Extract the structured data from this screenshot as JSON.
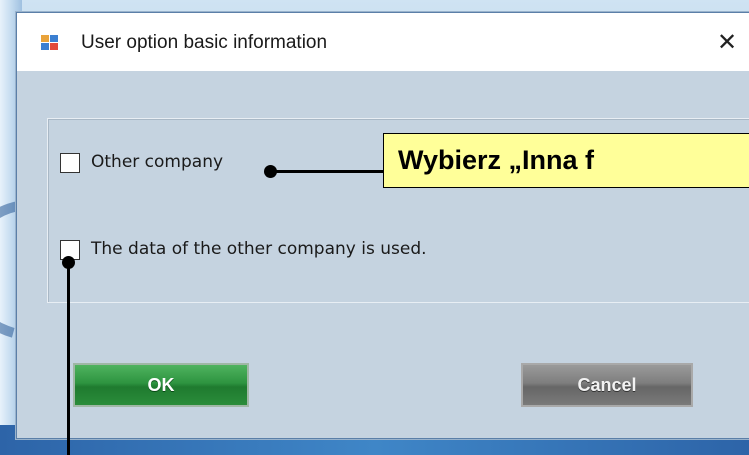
{
  "window": {
    "title": "User option basic information",
    "close_glyph": "✕"
  },
  "options": {
    "other_company": "Other company",
    "use_other_company_data": "The data of the other company is used."
  },
  "buttons": {
    "ok": "OK",
    "cancel": "Cancel"
  },
  "annotation": {
    "text": "Wybierz „Inna f"
  },
  "icons": {
    "app": "app-window-icon",
    "close": "close-icon"
  }
}
